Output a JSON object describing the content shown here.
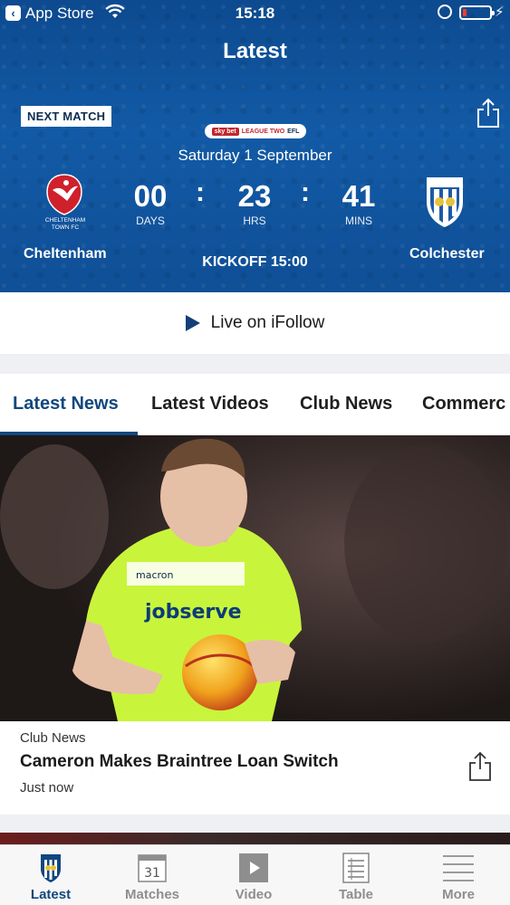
{
  "status_bar": {
    "back_app": "App Store",
    "time": "15:18",
    "battery_level_pct": 15
  },
  "header": {
    "title": "Latest"
  },
  "match": {
    "badge": "NEXT MATCH",
    "competition": {
      "sponsor": "sky bet",
      "league": "LEAGUE TWO",
      "org": "EFL"
    },
    "date": "Saturday 1 September",
    "home_team": "Cheltenham",
    "home_crest_caption": "CHELTENHAM TOWN FC",
    "away_team": "Colchester",
    "away_crest_caption": "COLCHESTER UNITED FC",
    "countdown": {
      "days": "00",
      "days_label": "DAYS",
      "hours": "23",
      "hours_label": "HRS",
      "mins": "41",
      "mins_label": "MINS",
      "separator": ":"
    },
    "kickoff": "KICKOFF 15:00"
  },
  "ifollow": {
    "label": "Live on iFollow"
  },
  "tabs": [
    {
      "label": "Latest News",
      "active": true
    },
    {
      "label": "Latest Videos",
      "active": false
    },
    {
      "label": "Club News",
      "active": false
    },
    {
      "label": "Commerc",
      "active": false
    }
  ],
  "article": {
    "category": "Club News",
    "title": "Cameron Makes Braintree Loan Switch",
    "time": "Just now",
    "shirt_sponsor": "jobserve",
    "kit_maker": "macron"
  },
  "bottom_nav": [
    {
      "label": "Latest",
      "icon": "club-crest-icon",
      "active": true
    },
    {
      "label": "Matches",
      "icon": "calendar-icon",
      "calendar_day": "31",
      "active": false
    },
    {
      "label": "Video",
      "icon": "video-play-icon",
      "active": false
    },
    {
      "label": "Table",
      "icon": "table-list-icon",
      "active": false
    },
    {
      "label": "More",
      "icon": "hamburger-menu-icon",
      "active": false
    }
  ],
  "colors": {
    "brand_blue": "#0f4f96",
    "active_tab": "#11477f",
    "kit_yellow": "#c8f53b"
  }
}
